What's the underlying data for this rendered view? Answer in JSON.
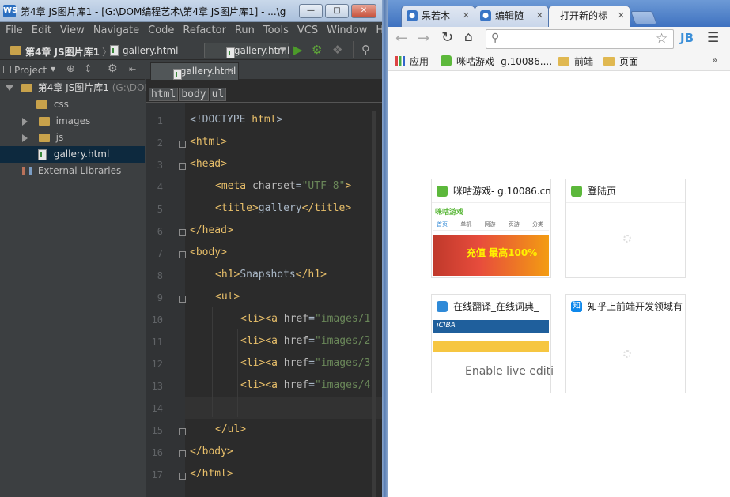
{
  "ide": {
    "window_title": "第4章 JS图片库1 - [G:\\DOM编程艺术\\第4章 JS图片库1] - ...\\g",
    "logo_text": "WS",
    "menu": [
      "File",
      "Edit",
      "View",
      "Navigate",
      "Code",
      "Refactor",
      "Run",
      "Tools",
      "VCS",
      "Window",
      "Help"
    ],
    "nav_project": "第4章 JS图片库1",
    "nav_file": "gallery.html",
    "run_config": "gallery.html",
    "project_label": "Project",
    "tree": [
      {
        "label": "第4章 JS图片库1",
        "extra": "(G:\\DOM",
        "type": "root"
      },
      {
        "label": "css",
        "type": "folder"
      },
      {
        "label": "images",
        "type": "folder"
      },
      {
        "label": "js",
        "type": "folder"
      },
      {
        "label": "gallery.html",
        "type": "file"
      },
      {
        "label": "External Libraries",
        "type": "lib"
      }
    ],
    "editor_tab": "gallery.html",
    "breadcrumb": [
      "html",
      "body",
      "ul"
    ],
    "line_numbers": [
      "1",
      "2",
      "3",
      "4",
      "5",
      "6",
      "7",
      "8",
      "9",
      "10",
      "11",
      "12",
      "13",
      "14",
      "15",
      "16",
      "17"
    ]
  },
  "browser": {
    "tabs": [
      {
        "label": "呆若木"
      },
      {
        "label": "编辑随"
      },
      {
        "label": "打开新的标"
      }
    ],
    "bookmarks": {
      "apps": "应用",
      "item1": "咪咕游戏- g.10086....",
      "folder1": "前端",
      "folder2": "页面",
      "more": "»"
    },
    "profile_text": "JB",
    "tiles": [
      {
        "title": "咪咕游戏- g.10086.cn"
      },
      {
        "title": "登陆页"
      },
      {
        "title": "在线翻译_在线词典_"
      },
      {
        "title": "知乎上前端开发领域有"
      }
    ],
    "tile_thumbs": {
      "migu_logo": "咪咕游戏",
      "migu_tabs": [
        "首页",
        "单机",
        "网游",
        "页游",
        "分类"
      ],
      "migu_banner": "充值 最高100%",
      "iciba_logo": "iCIBA",
      "iciba_text": "Enable live editi",
      "zhihu_icon": "知"
    }
  },
  "colors": {
    "ide_bg": "#2b2b2b",
    "tag": "#e8bf6a",
    "string": "#6a8759",
    "text": "#a9b7c6",
    "title_bar": "#aac0dc",
    "chrome_tab": "#3f72c0"
  }
}
